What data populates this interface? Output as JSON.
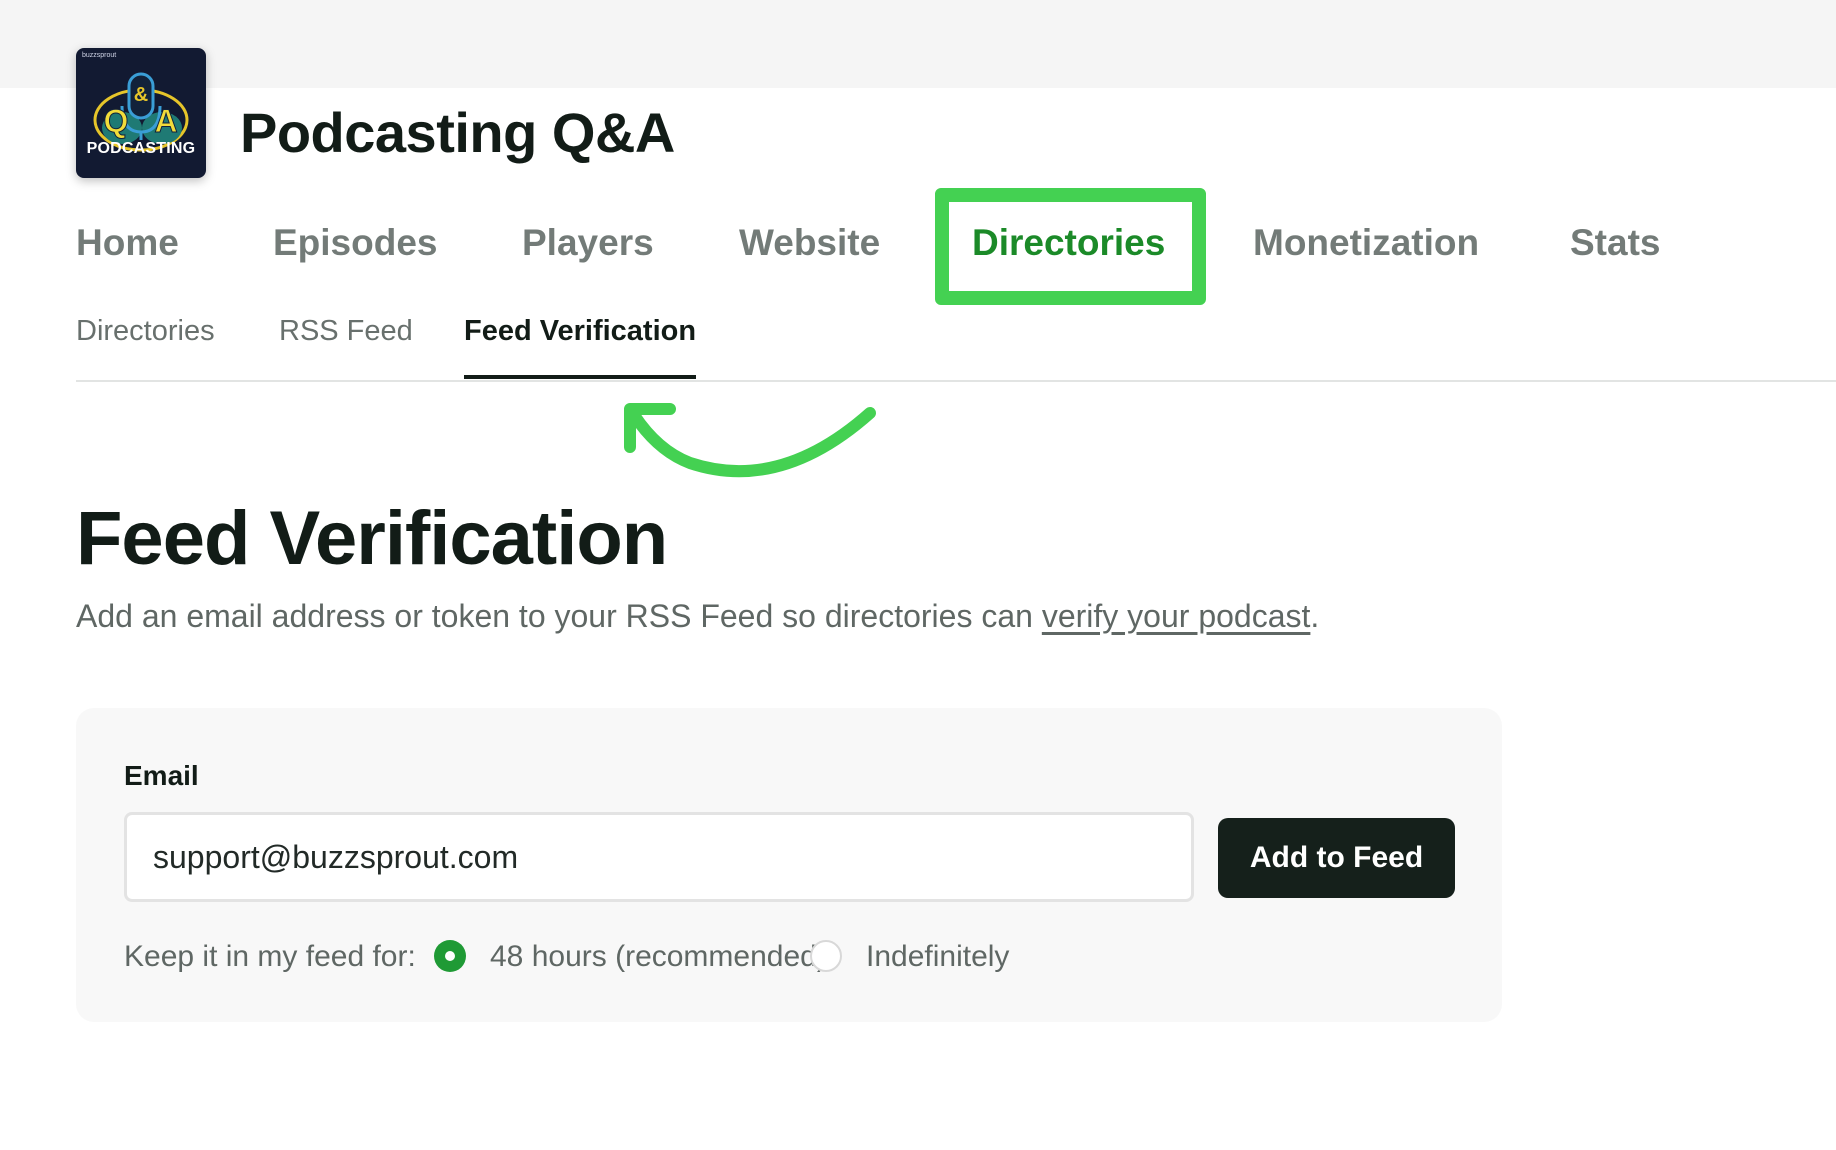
{
  "podcast": {
    "title": "Podcasting Q&A",
    "artwork": {
      "brand_text": "buzzsprout",
      "letters": [
        "Q",
        "&",
        "A"
      ],
      "caption": "PODCASTING",
      "icon": "microphone-icon"
    }
  },
  "main_nav": {
    "items": [
      {
        "label": "Home"
      },
      {
        "label": "Episodes"
      },
      {
        "label": "Players"
      },
      {
        "label": "Website"
      },
      {
        "label": "Directories",
        "active": true
      },
      {
        "label": "Monetization"
      },
      {
        "label": "Stats"
      }
    ]
  },
  "sub_nav": {
    "items": [
      {
        "label": "Directories"
      },
      {
        "label": "RSS Feed"
      },
      {
        "label": "Feed Verification",
        "active": true
      }
    ]
  },
  "page": {
    "heading": "Feed Verification",
    "description_prefix": "Add an email address or token to your RSS Feed so directories can ",
    "description_link": "verify your podcast",
    "description_suffix": "."
  },
  "form": {
    "email_label": "Email",
    "email_value": "support@buzzsprout.com",
    "add_button": "Add to Feed",
    "keep_label": "Keep it in my feed for:",
    "options": [
      {
        "label": "48 hours (recommended)",
        "checked": true
      },
      {
        "label": "Indefinitely",
        "checked": false
      }
    ]
  },
  "colors": {
    "active_nav": "#1b8a28",
    "annotation_green": "#44d152",
    "button_dark": "#15201b",
    "radio_checked": "#1f9a35"
  }
}
